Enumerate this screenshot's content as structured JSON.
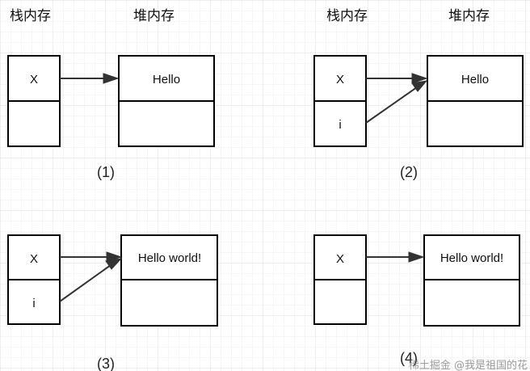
{
  "headers": {
    "stack": "栈内存",
    "heap": "堆内存"
  },
  "panels": [
    {
      "caption": "(1)",
      "stack_cells": [
        "X",
        ""
      ],
      "heap_value": "Hello",
      "references": [
        "X"
      ]
    },
    {
      "caption": "(2)",
      "stack_cells": [
        "X",
        "i"
      ],
      "heap_value": "Hello",
      "references": [
        "X",
        "i"
      ]
    },
    {
      "caption": "(3)",
      "stack_cells": [
        "X",
        "i"
      ],
      "heap_value": "Hello world!",
      "references": [
        "X",
        "i"
      ]
    },
    {
      "caption": "(4)",
      "stack_cells": [
        "X",
        ""
      ],
      "heap_value": "Hello world!",
      "references": [
        "X"
      ]
    }
  ],
  "watermark": "稀土掘金 @我是祖国的花"
}
